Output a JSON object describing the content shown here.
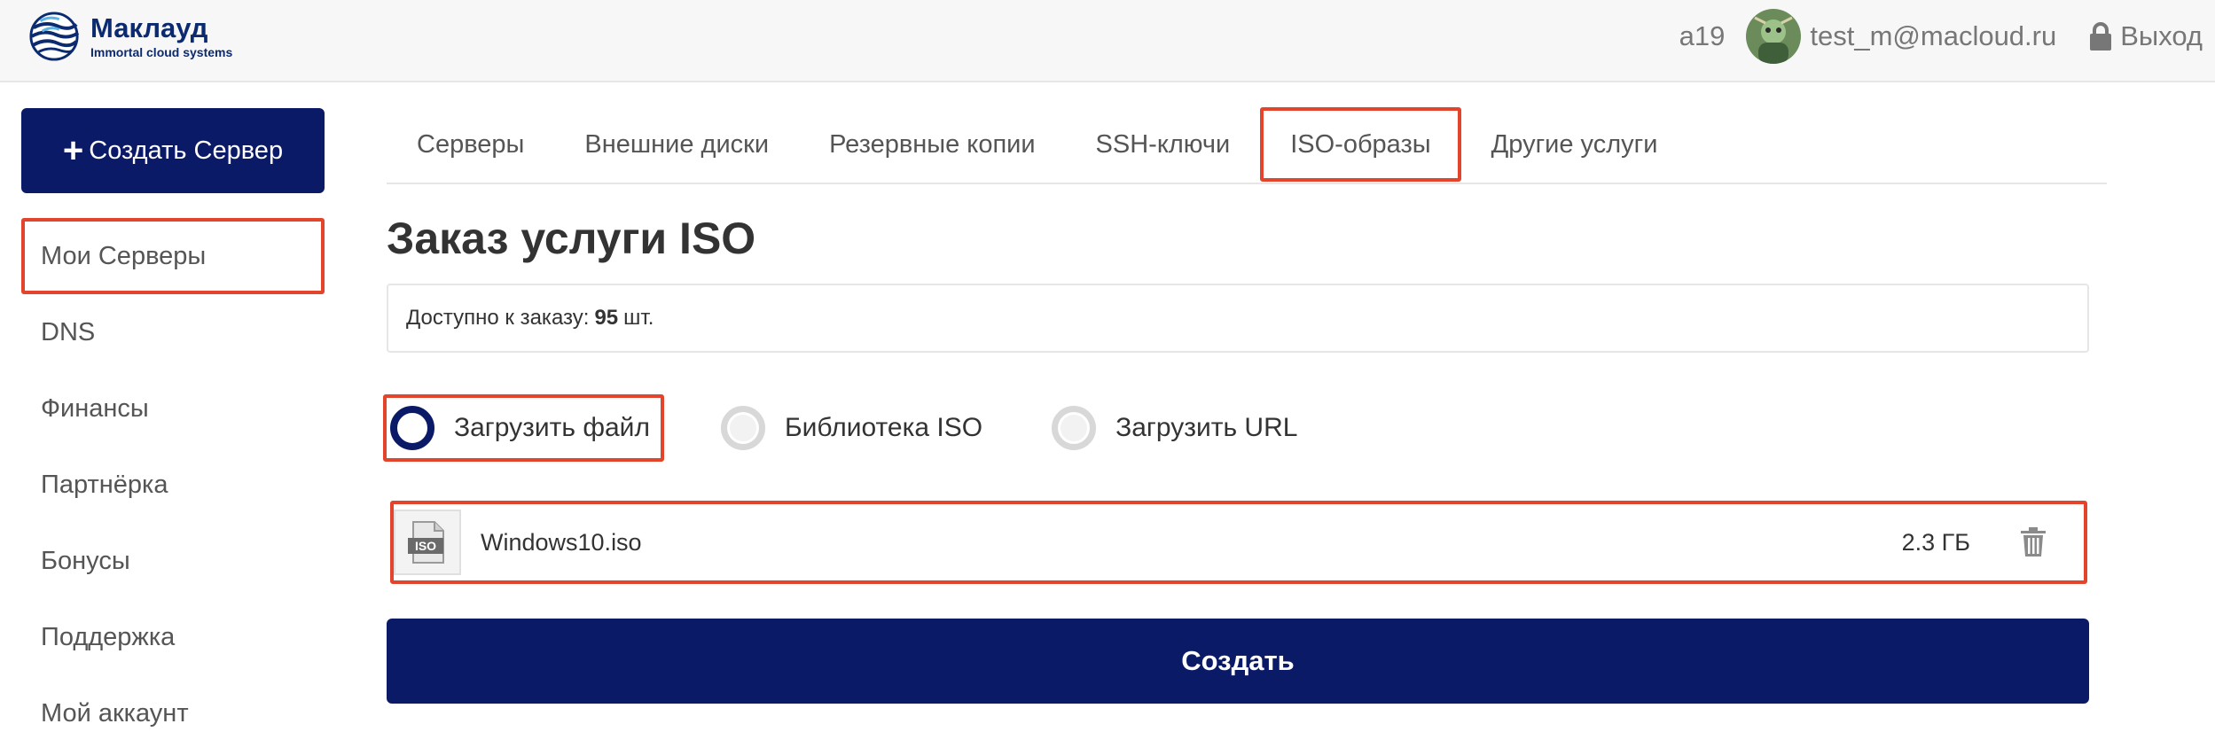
{
  "header": {
    "logo_title": "Маклауд",
    "logo_subtitle": "Immortal cloud systems",
    "account_id": "a19",
    "email": "test_m@macloud.ru",
    "logout_label": "Выход"
  },
  "sidebar": {
    "create_label": "Создать Сервер",
    "items": [
      {
        "label": "Мои Серверы",
        "active": true
      },
      {
        "label": "DNS"
      },
      {
        "label": "Финансы"
      },
      {
        "label": "Партнёрка"
      },
      {
        "label": "Бонусы"
      },
      {
        "label": "Поддержка"
      },
      {
        "label": "Мой аккаунт"
      }
    ]
  },
  "tabs": [
    {
      "label": "Серверы"
    },
    {
      "label": "Внешние диски"
    },
    {
      "label": "Резервные копии"
    },
    {
      "label": "SSH-ключи"
    },
    {
      "label": "ISO-образы",
      "active": true
    },
    {
      "label": "Другие услуги"
    }
  ],
  "main": {
    "title": "Заказ услуги ISO",
    "available_prefix": "Доступно к заказу:",
    "available_count": "95",
    "available_unit": "шт.",
    "options": [
      {
        "label": "Загрузить файл",
        "selected": true
      },
      {
        "label": "Библиотека ISO",
        "selected": false
      },
      {
        "label": "Загрузить URL",
        "selected": false
      }
    ],
    "file": {
      "icon_text": "ISO",
      "name": "Windows10.iso",
      "size": "2.3 ГБ"
    },
    "submit_label": "Создать"
  },
  "colors": {
    "brand_navy": "#0b1a66",
    "highlight_red": "#e2452c",
    "logo_blue": "#0b2a6f"
  },
  "icons": {
    "logo": "macloud-globe-logo",
    "lock": "lock-icon",
    "plus": "plus-icon",
    "file": "iso-file-icon",
    "trash": "trash-icon"
  }
}
